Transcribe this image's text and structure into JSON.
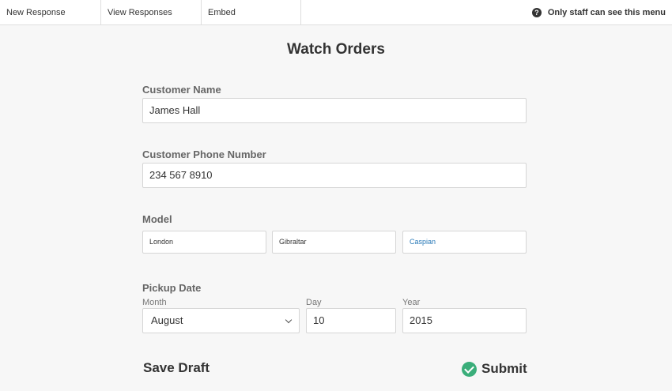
{
  "topbar": {
    "tabs": [
      {
        "label": "New Response"
      },
      {
        "label": "View Responses"
      },
      {
        "label": "Embed"
      }
    ],
    "staff_notice": "Only staff can see this menu",
    "help_icon": "question-circle-icon"
  },
  "form": {
    "title": "Watch Orders",
    "customer_name": {
      "label": "Customer Name",
      "value": "James Hall"
    },
    "customer_phone": {
      "label": "Customer Phone Number",
      "value": "234 567 8910"
    },
    "model": {
      "label": "Model",
      "options": [
        "London",
        "Gibraltar",
        "Caspian"
      ],
      "selected": "Caspian"
    },
    "pickup_date": {
      "label": "Pickup Date",
      "month": {
        "label": "Month",
        "value": "August"
      },
      "day": {
        "label": "Day",
        "value": "10"
      },
      "year": {
        "label": "Year",
        "value": "2015"
      }
    },
    "save_draft_label": "Save Draft",
    "submit_label": "Submit"
  },
  "colors": {
    "accent_link": "#2a7ab8",
    "submit_check": "#3aae7a"
  }
}
